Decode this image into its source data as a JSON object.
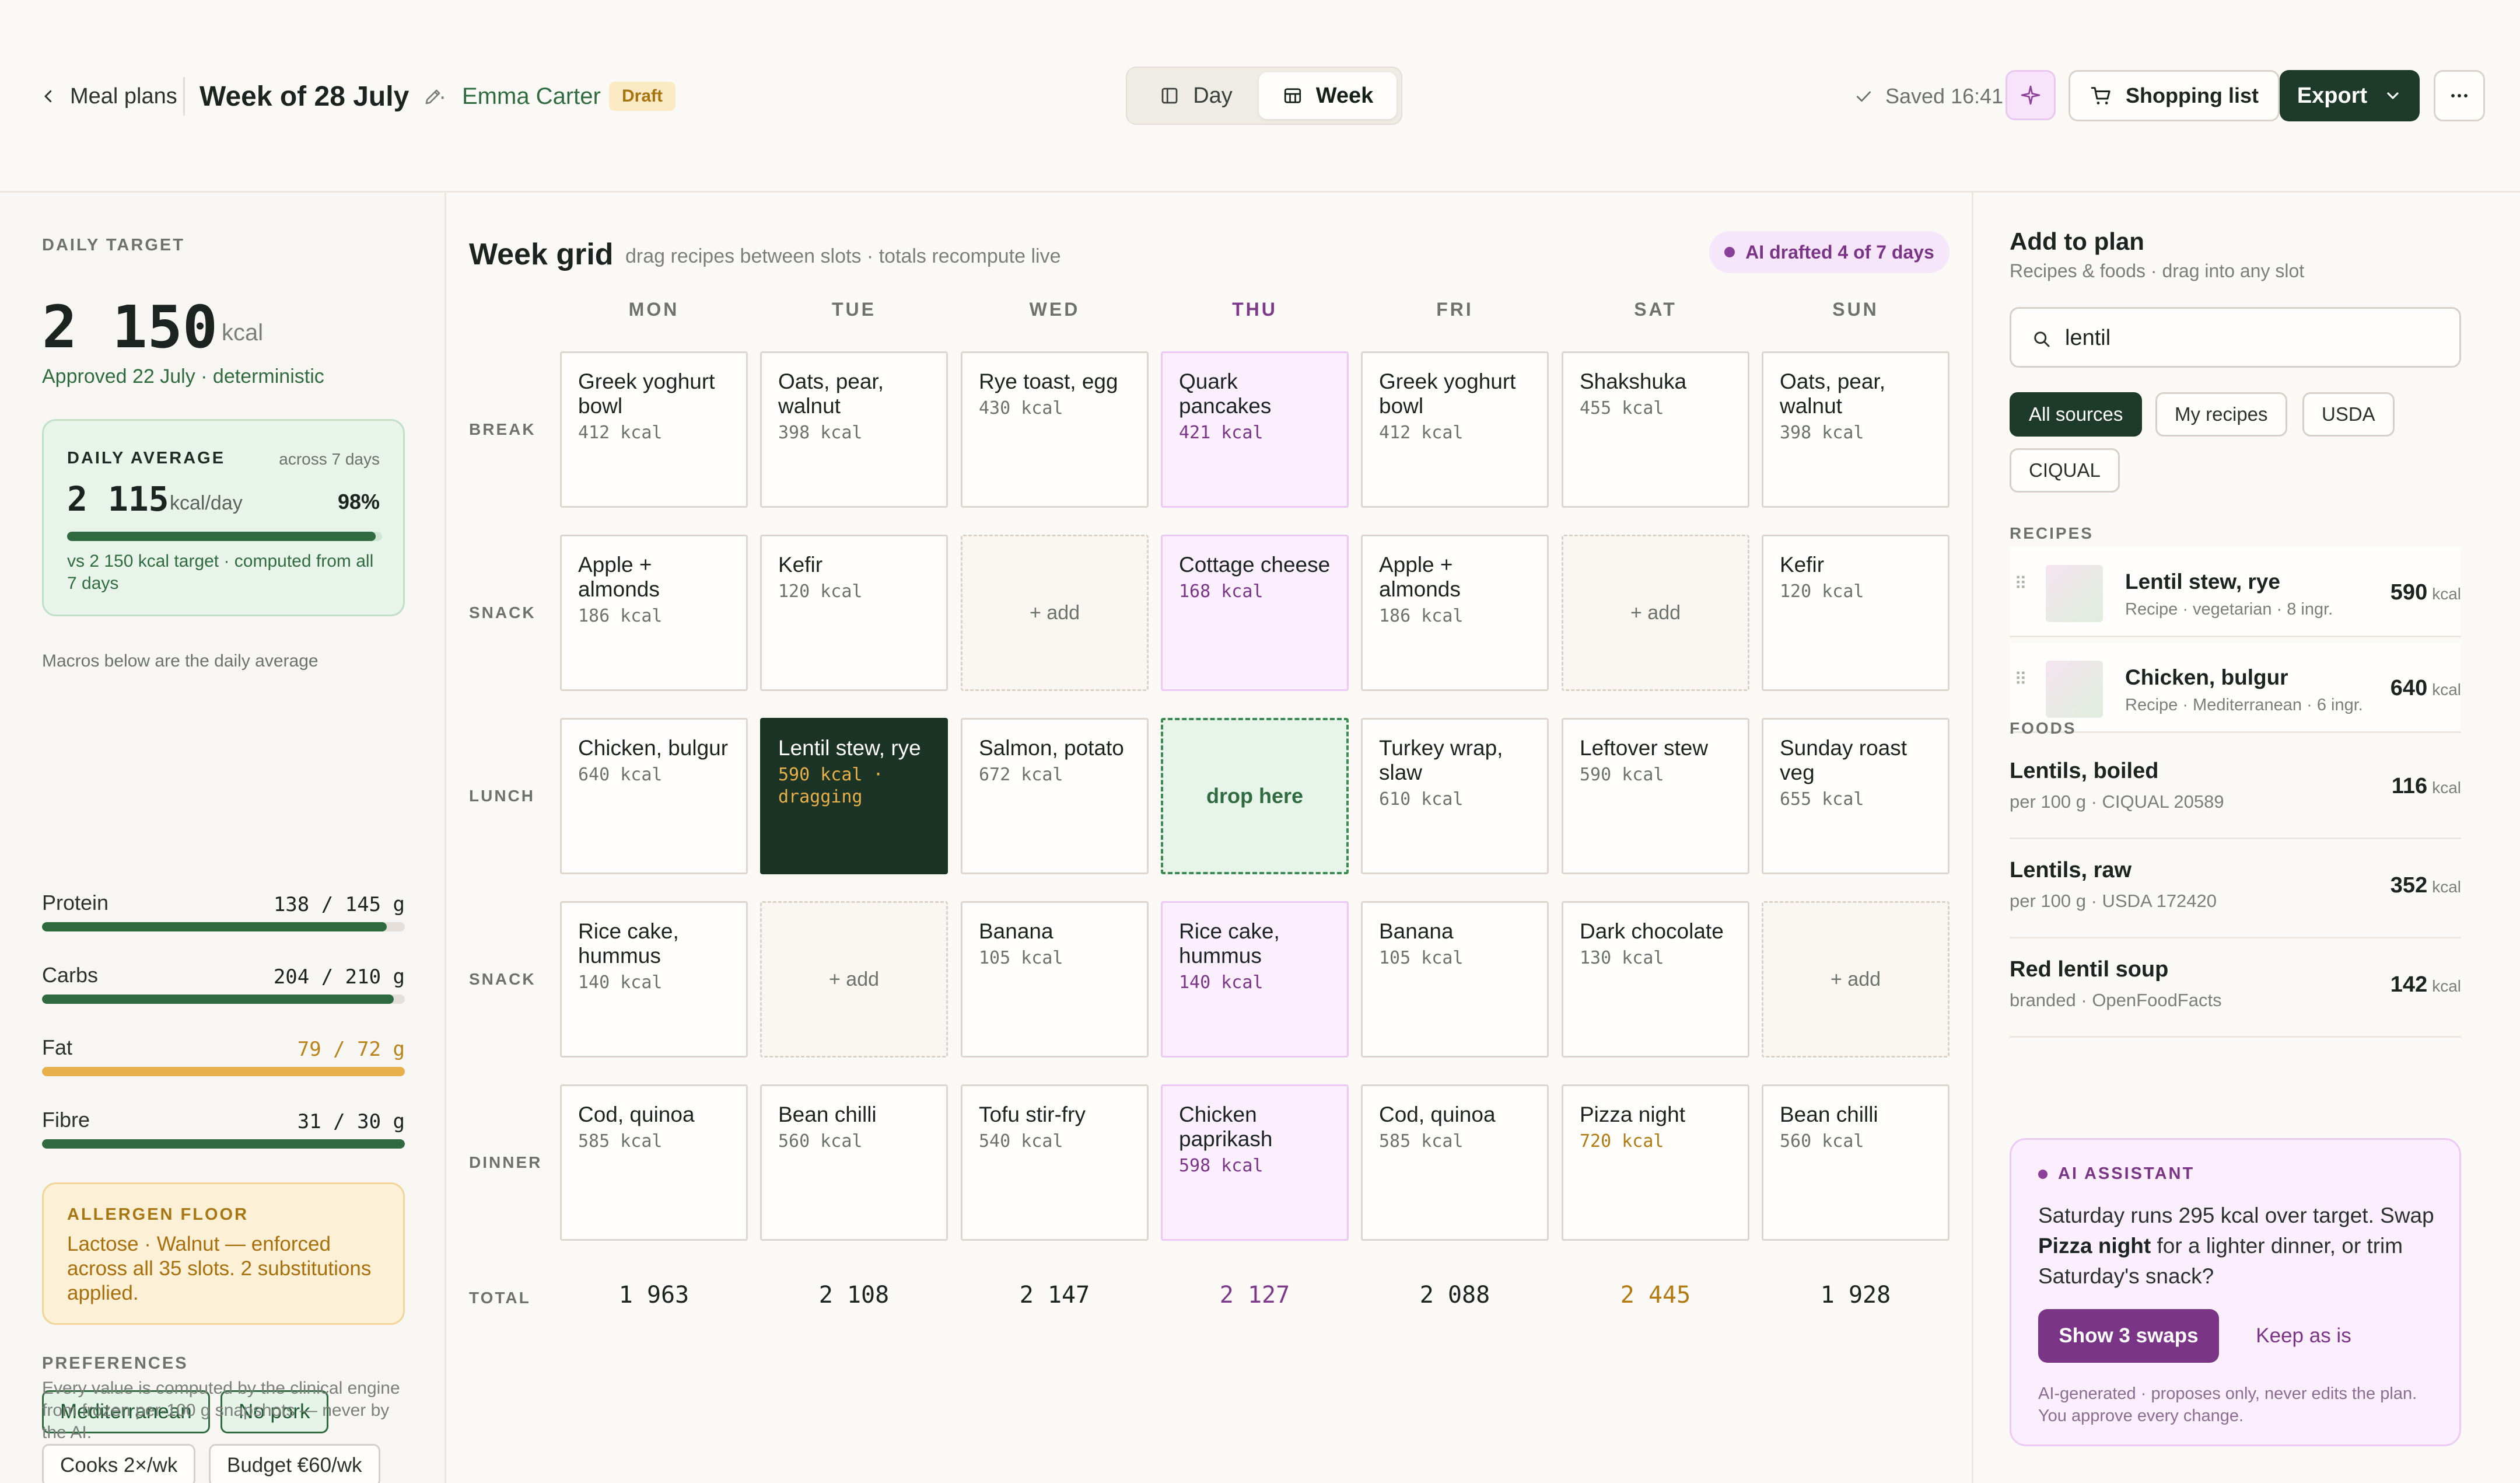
{
  "header": {
    "back_label": "Meal plans",
    "title": "Week of 28 July",
    "dot": "·",
    "client": "Emma Carter",
    "status_badge": "Draft",
    "view_tabs": [
      {
        "label": "Day"
      },
      {
        "label": "Week"
      }
    ],
    "active_view": "Week",
    "saved": "Saved 16:41",
    "shopping_label": "Shopping list",
    "export_label": "Export"
  },
  "left": {
    "daily_target_label": "DAILY TARGET",
    "target_value": "2 150",
    "target_unit": "kcal",
    "approved": "Approved 22 July · deterministic",
    "daily_average": {
      "label": "DAILY AVERAGE",
      "across": "across 7 days",
      "value": "2 115",
      "unit": "kcal/day",
      "percent": "98%",
      "fill_fraction": 0.98,
      "note": "vs 2 150 kcal target · computed from all 7 days"
    },
    "macros_note": "Macros below are the daily average",
    "macros": [
      {
        "name": "Protein",
        "value": "138 / 145 g",
        "fraction": 0.95,
        "warn": false
      },
      {
        "name": "Carbs",
        "value": "204 / 210 g",
        "fraction": 0.97,
        "warn": false
      },
      {
        "name": "Fat",
        "value": "79 / 72 g",
        "fraction": 1.0,
        "warn": true
      },
      {
        "name": "Fibre",
        "value": "31 / 30 g",
        "fraction": 1.0,
        "warn": false
      }
    ],
    "allergen": {
      "label": "ALLERGEN FLOOR",
      "text": "Lactose · Walnut — enforced across all 35 slots. 2 substitutions applied."
    },
    "preferences_label": "PREFERENCES",
    "preferences": [
      {
        "label": "Mediterranean",
        "style": "green"
      },
      {
        "label": "No pork",
        "style": "green"
      },
      {
        "label": "Cooks 2×/wk",
        "style": "plain"
      },
      {
        "label": "Budget €60/wk",
        "style": "plain"
      }
    ],
    "footnote": "Every value is computed by the clinical engine from frozen per-100 g snapshots — never by the AI."
  },
  "grid": {
    "title": "Week grid",
    "subtitle": "drag recipes between slots · totals recompute live",
    "ai_pill": "AI drafted 4 of 7 days",
    "days": [
      "MON",
      "TUE",
      "WED",
      "THU",
      "FRI",
      "SAT",
      "SUN"
    ],
    "highlight_day": 3,
    "rows": [
      {
        "label": "BREAK",
        "cells": [
          {
            "name": "Greek yoghurt bowl",
            "kcal": "412 kcal"
          },
          {
            "name": "Oats, pear, walnut",
            "kcal": "398 kcal"
          },
          {
            "name": "Rye toast, egg",
            "kcal": "430 kcal"
          },
          {
            "name": "Quark pancakes",
            "kcal": "421 kcal"
          },
          {
            "name": "Greek yoghurt bowl",
            "kcal": "412 kcal"
          },
          {
            "name": "Shakshuka",
            "kcal": "455 kcal"
          },
          {
            "name": "Oats, pear, walnut",
            "kcal": "398 kcal"
          }
        ]
      },
      {
        "label": "SNACK",
        "cells": [
          {
            "name": "Apple + almonds",
            "kcal": "186 kcal"
          },
          {
            "name": "Kefir",
            "kcal": "120 kcal"
          },
          {
            "empty": "+ add"
          },
          {
            "name": "Cottage cheese",
            "kcal": "168 kcal"
          },
          {
            "name": "Apple + almonds",
            "kcal": "186 kcal"
          },
          {
            "empty": "+ add"
          },
          {
            "name": "Kefir",
            "kcal": "120 kcal"
          }
        ]
      },
      {
        "label": "LUNCH",
        "cells": [
          {
            "name": "Chicken, bulgur",
            "kcal": "640 kcal"
          },
          {
            "name": "Lentil stew, rye",
            "kcal": "590 kcal · dragging",
            "dragging": true
          },
          {
            "name": "Salmon, potato",
            "kcal": "672 kcal"
          },
          {
            "drop": "drop here"
          },
          {
            "name": "Turkey wrap, slaw",
            "kcal": "610 kcal"
          },
          {
            "name": "Leftover stew",
            "kcal": "590 kcal"
          },
          {
            "name": "Sunday roast veg",
            "kcal": "655 kcal"
          }
        ]
      },
      {
        "label": "SNACK",
        "cells": [
          {
            "name": "Rice cake, hummus",
            "kcal": "140 kcal"
          },
          {
            "empty": "+ add"
          },
          {
            "name": "Banana",
            "kcal": "105 kcal"
          },
          {
            "name": "Rice cake, hummus",
            "kcal": "140 kcal"
          },
          {
            "name": "Banana",
            "kcal": "105 kcal"
          },
          {
            "name": "Dark chocolate",
            "kcal": "130 kcal"
          },
          {
            "empty": "+ add"
          }
        ]
      },
      {
        "label": "DINNER",
        "cells": [
          {
            "name": "Cod, quinoa",
            "kcal": "585 kcal"
          },
          {
            "name": "Bean chilli",
            "kcal": "560 kcal"
          },
          {
            "name": "Tofu stir-fry",
            "kcal": "540 kcal"
          },
          {
            "name": "Chicken paprikash",
            "kcal": "598 kcal"
          },
          {
            "name": "Cod, quinoa",
            "kcal": "585 kcal"
          },
          {
            "name": "Pizza night",
            "kcal": "720 kcal",
            "warn": true
          },
          {
            "name": "Bean chilli",
            "kcal": "560 kcal"
          }
        ]
      }
    ],
    "total_label": "TOTAL",
    "totals": [
      {
        "value": "1 963"
      },
      {
        "value": "2 108"
      },
      {
        "value": "2 147"
      },
      {
        "value": "2 127"
      },
      {
        "value": "2 088"
      },
      {
        "value": "2 445",
        "warn": true
      },
      {
        "value": "1 928"
      }
    ]
  },
  "right": {
    "title": "Add to plan",
    "subtitle": "Recipes & foods · drag into any slot",
    "search_value": "lentil",
    "sources": [
      "All sources",
      "My recipes",
      "USDA",
      "CIQUAL"
    ],
    "active_source": "All sources",
    "recipes_label": "RECIPES",
    "recipes": [
      {
        "name": "Lentil stew, rye",
        "meta": "Recipe · vegetarian · 8 ingr.",
        "kcal": "590",
        "unit": "kcal"
      },
      {
        "name": "Chicken, bulgur",
        "meta": "Recipe · Mediterranean · 6 ingr.",
        "kcal": "640",
        "unit": "kcal"
      }
    ],
    "foods_label": "FOODS",
    "foods": [
      {
        "name": "Lentils, boiled",
        "meta": "per 100 g · CIQUAL 20589",
        "kcal": "116",
        "unit": "kcal"
      },
      {
        "name": "Lentils, raw",
        "meta": "per 100 g · USDA 172420",
        "kcal": "352",
        "unit": "kcal"
      },
      {
        "name": "Red lentil soup",
        "meta": "branded · OpenFoodFacts",
        "kcal": "142",
        "unit": "kcal"
      }
    ],
    "ai": {
      "label": "AI ASSISTANT",
      "msg_1": "Saturday runs 295 kcal over target. Swap ",
      "msg_bold": "Pizza night",
      "msg_2": " for a lighter dinner, or trim Saturday's snack?",
      "primary": "Show 3 swaps",
      "secondary": "Keep as is",
      "footer": "AI-generated · proposes only, never edits the plan. You approve every change."
    }
  },
  "colors": {
    "brand_green": "#1e3a2b",
    "accent_green": "#2f6b3f",
    "ai_purple": "#7a3587",
    "warn_amber": "#b27a10"
  },
  "icons": [
    "chevron-left-icon",
    "pencil-icon",
    "day-view-icon",
    "week-grid-icon",
    "check-icon",
    "sparkle-icon",
    "cart-icon",
    "chevron-down-icon",
    "more-horizontal-icon",
    "search-icon",
    "drag-handle-icon"
  ]
}
